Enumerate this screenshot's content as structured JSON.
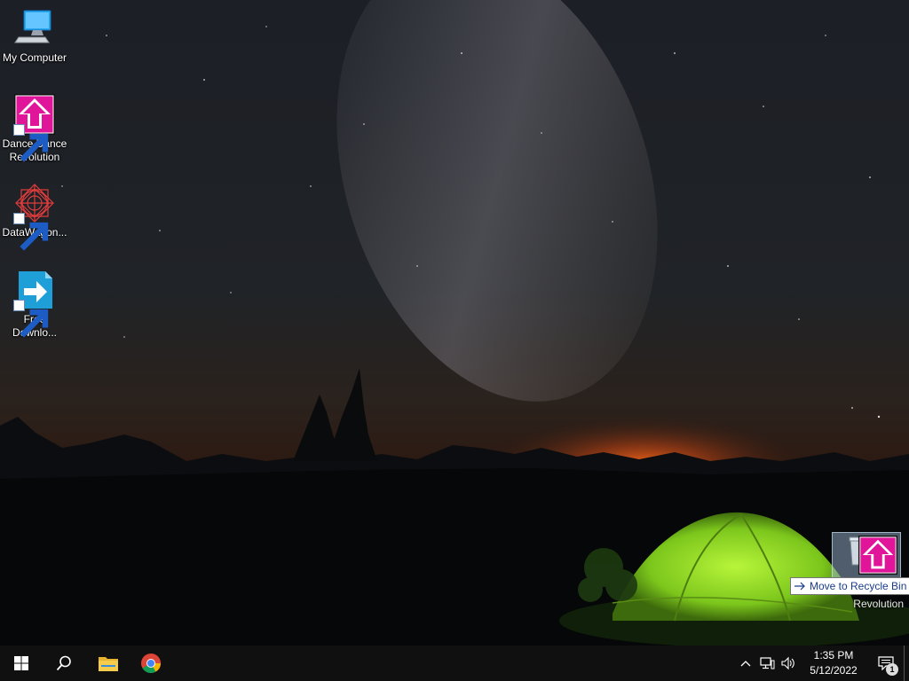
{
  "desktop": {
    "icons": [
      {
        "label": "My Computer",
        "icon": "computer-icon"
      },
      {
        "label": "Dance Dance\nRevolution",
        "icon": "ddr-arrow-icon"
      },
      {
        "label": "DataWagon...",
        "icon": "datawagon-icon"
      },
      {
        "label": "Free\nDownlo...",
        "icon": "free-download-icon"
      }
    ]
  },
  "drag": {
    "tooltip": "Move to Recycle Bin",
    "ghost_label": "Revolution",
    "tooltip_icon": "arrow-right-icon"
  },
  "taskbar": {
    "start_icon": "windows-logo-icon",
    "search_icon": "search-icon",
    "pinned": [
      {
        "name": "File Explorer",
        "icon": "folder-icon"
      },
      {
        "name": "Google Chrome",
        "icon": "chrome-icon"
      }
    ],
    "tray": {
      "chevron_icon": "chevron-up-icon",
      "network_icon": "network-icon",
      "volume_icon": "volume-icon",
      "time": "1:35 PM",
      "date": "5/12/2022",
      "notification_count": "1"
    }
  },
  "colors": {
    "ddr_pink": "#e0159a",
    "taskbar_bg": "#101010",
    "tent_green": "#8fd82a",
    "horizon_orange": "#e2661a"
  }
}
